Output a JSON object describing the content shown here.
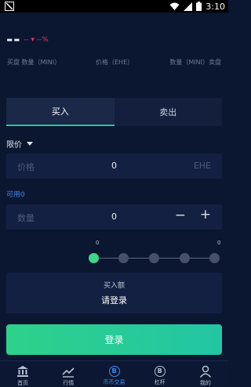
{
  "status_bar": {
    "time": "3:10"
  },
  "ticker": {
    "price": "--",
    "change": "-- ▾ --%"
  },
  "book_headers": {
    "left": "买盘 数量（MINI）",
    "mid": "价格（EHE）",
    "right": "数量（MINI）卖盘"
  },
  "tabs": [
    {
      "label": "买入",
      "active": true
    },
    {
      "label": "卖出",
      "active": false
    }
  ],
  "order_type": {
    "label": "限价"
  },
  "price_field": {
    "placeholder": "价格",
    "value": "0",
    "unit": "EHE"
  },
  "available": {
    "label": "可用0"
  },
  "quantity_field": {
    "placeholder": "数量",
    "value": "0",
    "minus": "−",
    "plus": "+"
  },
  "slider": {
    "left_value": "0",
    "right_value": "0",
    "steps": 5,
    "active_step": 0
  },
  "amount": {
    "label": "买入额",
    "value": "请登录"
  },
  "login_button": {
    "label": "登录"
  },
  "bottom_nav": [
    {
      "label": "首页",
      "icon": "bank-icon"
    },
    {
      "label": "行情",
      "icon": "chart-line-icon"
    },
    {
      "label": "币币交易",
      "icon": "coin-icon",
      "active": true
    },
    {
      "label": "杠杆",
      "icon": "coin-icon"
    },
    {
      "label": "我的",
      "icon": "user-icon"
    }
  ],
  "colors": {
    "background": "#0b1631",
    "accent_green": "#2ed18a",
    "accent_blue": "#3d8bf2",
    "down_red": "#e23b58"
  }
}
